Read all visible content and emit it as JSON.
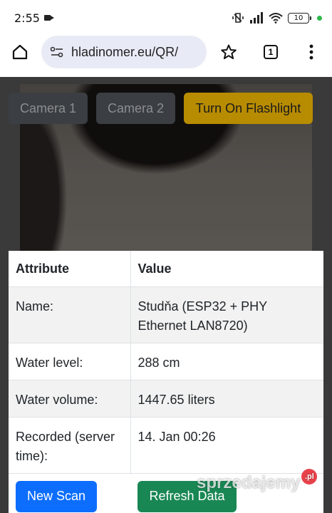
{
  "status_bar": {
    "time": "2:55",
    "battery": "10"
  },
  "browser": {
    "url": "hladinomer.eu/QR/",
    "tab_count": "1"
  },
  "camera_buttons": {
    "camera1": "Camera 1",
    "camera2": "Camera 2",
    "flashlight": "Turn On Flashlight"
  },
  "table": {
    "headers": [
      "Attribute",
      "Value"
    ],
    "rows": [
      {
        "attribute": "Name:",
        "value": "Studňa (ESP32 + PHY Ethernet LAN8720)"
      },
      {
        "attribute": "Water level:",
        "value": "288 cm"
      },
      {
        "attribute": "Water volume:",
        "value": "1447.65 liters"
      },
      {
        "attribute": "Recorded (server time):",
        "value": "14. Jan 00:26"
      }
    ]
  },
  "actions": {
    "new_scan": "New Scan",
    "refresh": "Refresh Data"
  },
  "watermark": {
    "text": "sprzedajemy",
    "badge": ".pl"
  },
  "colors": {
    "primary": "#0d6efd",
    "success": "#198754",
    "warning": "#b88c00"
  }
}
